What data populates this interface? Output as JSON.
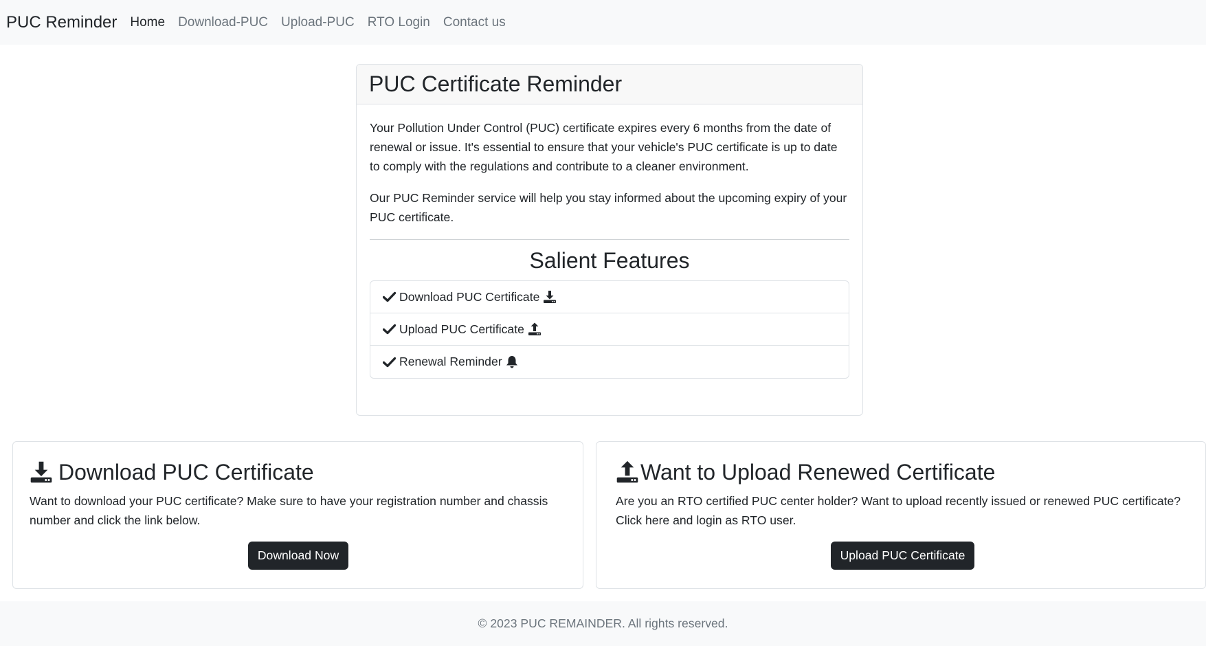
{
  "nav": {
    "brand": "PUC Reminder",
    "links": [
      "Home",
      "Download-PUC",
      "Upload-PUC",
      "RTO Login",
      "Contact us"
    ]
  },
  "main_card": {
    "title": "PUC Certificate Reminder",
    "paragraph1": "Your Pollution Under Control (PUC) certificate expires every 6 months from the date of renewal or issue. It's essential to ensure that your vehicle's PUC certificate is up to date to comply with the regulations and contribute to a cleaner environment.",
    "paragraph2": "Our PUC Reminder service will help you stay informed about the upcoming expiry of your PUC certificate.",
    "features_title": "Salient Features",
    "features": [
      {
        "label": "Download PUC Certificate",
        "icon": "download-icon"
      },
      {
        "label": "Upload PUC Certificate",
        "icon": "upload-icon"
      },
      {
        "label": "Renewal Reminder",
        "icon": "bell-icon"
      }
    ]
  },
  "download_card": {
    "title": "Download PUC Certificate",
    "text": "Want to download your PUC certificate? Make sure to have your registration number and chassis number and click the link below.",
    "button": "Download Now",
    "icon": "download-icon"
  },
  "upload_card": {
    "title": "Want to Upload Renewed Certificate",
    "text": "Are you an RTO certified PUC center holder? Want to upload recently issued or renewed PUC certificate? Click here and login as RTO user.",
    "button": "Upload PUC Certificate",
    "icon": "upload-icon"
  },
  "footer": {
    "text": "© 2023 PUC REMAINDER. All rights reserved."
  },
  "colors": {
    "navbar_bg": "#f8f9fa",
    "button_bg": "#212529",
    "muted_text": "#6c757d"
  }
}
